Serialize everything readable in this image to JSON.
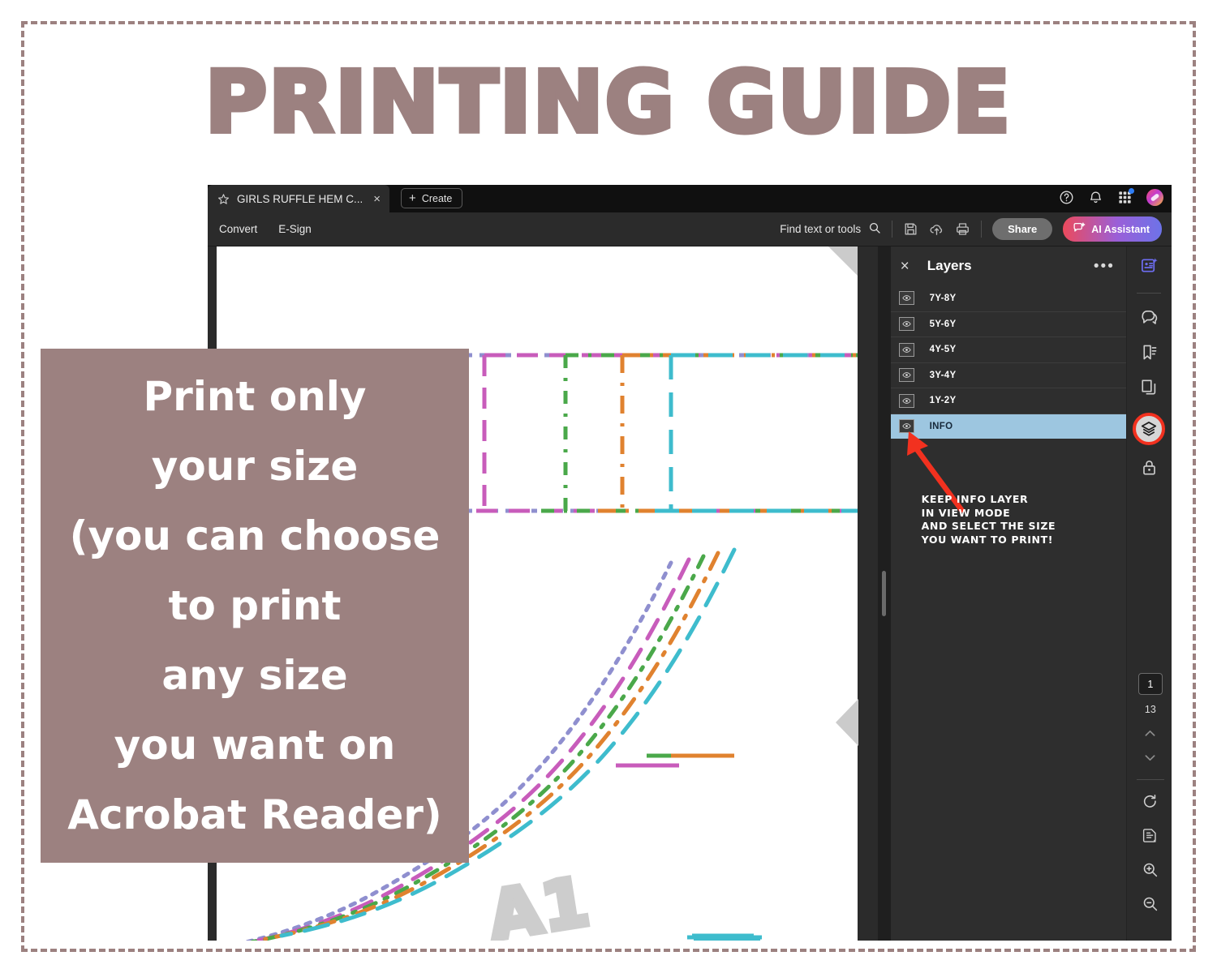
{
  "title": "PRINTING GUIDE",
  "colors": {
    "accent_mauve": "#9c8180",
    "arrow_red": "#f2311f",
    "layer_selected": "#9dc6e0",
    "panel_bg": "#2e2e2e",
    "window_bg": "#2b2b2b",
    "pattern_purple": "#8f8fcf",
    "pattern_magenta": "#c85cbb",
    "pattern_green": "#4aa84a",
    "pattern_orange": "#e0822f",
    "pattern_teal": "#3ebccd"
  },
  "acrobat": {
    "tab": {
      "favorite_icon": "star-icon",
      "title": "GIRLS RUFFLE HEM C...",
      "close_label": "×",
      "create_label": "Create",
      "create_plus": "+"
    },
    "tabbar_icons": [
      {
        "name": "help-icon",
        "label": "Help"
      },
      {
        "name": "notifications-bell-icon",
        "label": "Notifications"
      },
      {
        "name": "app-switcher-grid-icon",
        "label": "Apps"
      },
      {
        "name": "avatar",
        "label": "Account"
      }
    ],
    "command_bar": {
      "menu_items": [
        "Convert",
        "E-Sign"
      ],
      "find_placeholder": "Find text or tools",
      "icons": [
        {
          "name": "save-icon",
          "label": "Save"
        },
        {
          "name": "cloud-upload-icon",
          "label": "Upload to cloud"
        },
        {
          "name": "print-icon",
          "label": "Print"
        }
      ],
      "share_label": "Share",
      "ai_assistant_label": "AI Assistant"
    },
    "layers_panel": {
      "close_label": "×",
      "title": "Layers",
      "more_label": "•••",
      "layers": [
        {
          "name": "7Y-8Y",
          "selected": false,
          "visible": true
        },
        {
          "name": "5Y-6Y",
          "selected": false,
          "visible": true
        },
        {
          "name": "4Y-5Y",
          "selected": false,
          "visible": true
        },
        {
          "name": "3Y-4Y",
          "selected": false,
          "visible": true
        },
        {
          "name": "1Y-2Y",
          "selected": false,
          "visible": true
        },
        {
          "name": "INFO",
          "selected": true,
          "visible": true
        }
      ],
      "annotation": "KEEP INFO LAYER\nIN VIEW MODE\nAND SELECT THE SIZE\nYOU WANT TO PRINT!"
    },
    "right_rail": {
      "top_icons": [
        {
          "name": "ai-edit-icon",
          "label": "Edit with AI"
        },
        {
          "name": "comment-icon",
          "label": "Comment"
        },
        {
          "name": "bookmark-icon",
          "label": "Bookmarks"
        },
        {
          "name": "page-thumbnails-icon",
          "label": "Page thumbnails"
        },
        {
          "name": "layers-icon",
          "label": "Layers",
          "active": true
        },
        {
          "name": "lock-icon",
          "label": "Protect"
        }
      ],
      "page_current": "1",
      "page_total": "13",
      "bottom_icons": [
        {
          "name": "chevron-up-icon",
          "label": "Previous page"
        },
        {
          "name": "chevron-down-icon",
          "label": "Next page"
        },
        {
          "name": "rotate-icon",
          "label": "Rotate"
        },
        {
          "name": "fit-page-icon",
          "label": "Fit page"
        },
        {
          "name": "zoom-in-icon",
          "label": "Zoom in"
        },
        {
          "name": "zoom-out-icon",
          "label": "Zoom out"
        }
      ]
    },
    "document": {
      "piece_label": "A1"
    }
  },
  "overlay_callout": {
    "lines": [
      "Print only",
      "your size",
      "(you can choose",
      "to print",
      "any size",
      "you want on",
      "Acrobat Reader)"
    ]
  }
}
